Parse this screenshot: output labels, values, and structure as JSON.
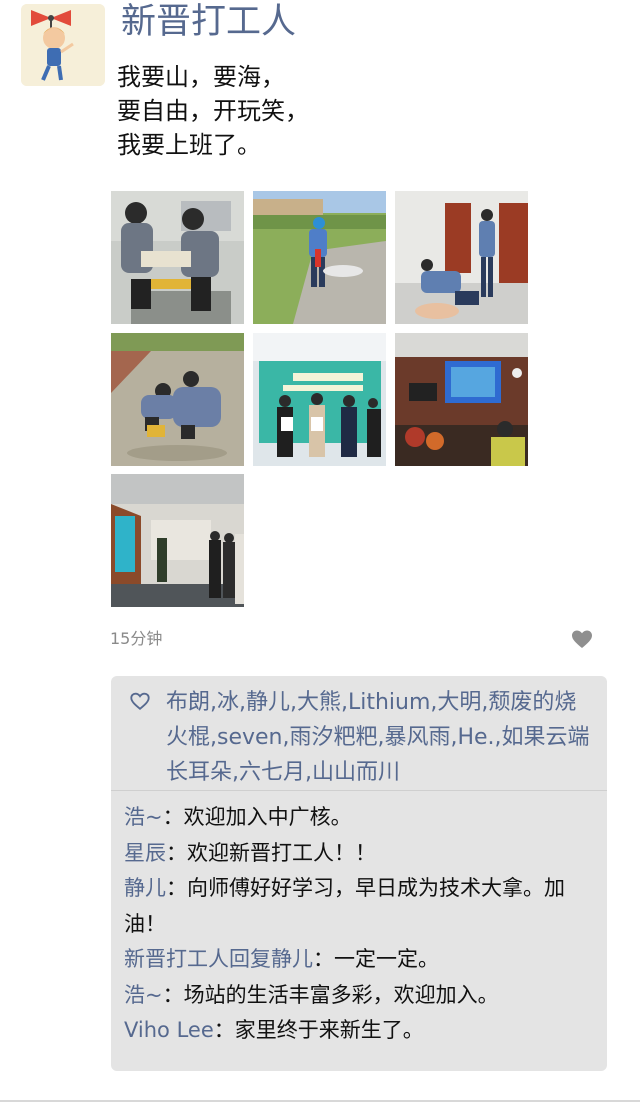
{
  "post": {
    "username": "新晋打工人",
    "avatar_icon": "cartoon-avatar-icon",
    "text_lines": [
      "我要山，要海，",
      "要自由，开玩笑，",
      "我要上班了。"
    ],
    "time": "15分钟",
    "like_icon": "heart-filled-icon"
  },
  "photos": [
    {
      "name": "photo-1",
      "subject": "two workers kneeling repairing equipment"
    },
    {
      "name": "photo-2",
      "subject": "worker with fire extinguisher on grass"
    },
    {
      "name": "photo-3",
      "subject": "CPR training indoors"
    },
    {
      "name": "photo-4",
      "subject": "workers crouching outdoors"
    },
    {
      "name": "photo-5",
      "subject": "group holding certificates"
    },
    {
      "name": "photo-6",
      "subject": "meeting room with screen"
    },
    {
      "name": "photo-7",
      "subject": "people standing in meeting hall"
    }
  ],
  "likes": {
    "icon": "heart-outline-icon",
    "names": "布朗,冰,静儿,大熊,Lithium,大明,颓废的烧火棍,seven,雨汐粑粑,暴风雨,He.,如果云端长耳朵,六七月,山山而川"
  },
  "comments": [
    {
      "author": "浩~",
      "sep": "：",
      "text": "欢迎加入中广核。"
    },
    {
      "author": "星辰",
      "sep": "：",
      "text": "欢迎新晋打工人！！"
    },
    {
      "author": "静儿",
      "sep": "：",
      "text": "向师傅好好学习，早日成为技术大拿。加油！"
    },
    {
      "author": "新晋打工人回复静儿",
      "sep": "：",
      "text": "一定一定。"
    },
    {
      "author": "浩~",
      "sep": "：",
      "text": "场站的生活丰富多彩，欢迎加入。"
    },
    {
      "author": "Viho Lee",
      "sep": "：",
      "text": "家里终于来新生了。"
    }
  ]
}
